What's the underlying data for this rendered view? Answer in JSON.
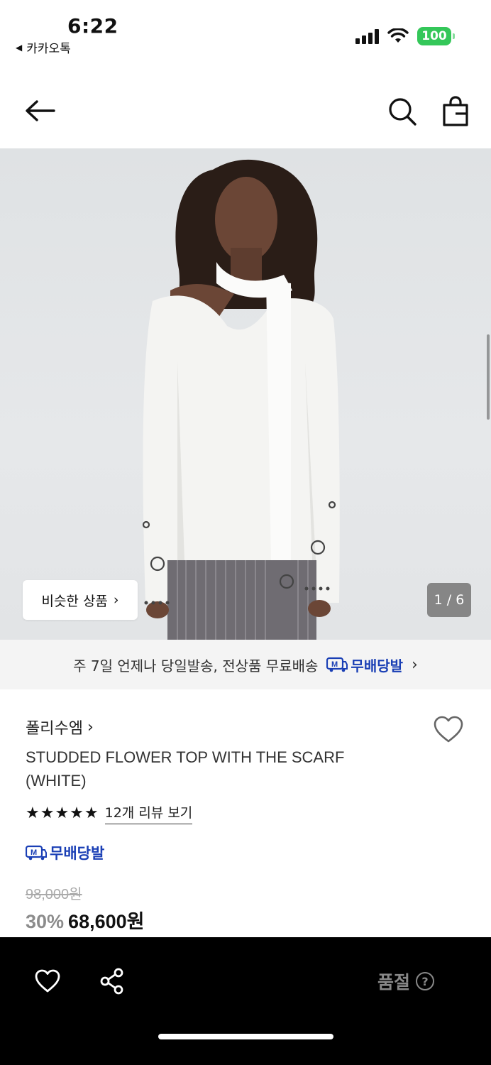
{
  "status_bar": {
    "time": "6:22",
    "back_app": "카카오톡",
    "battery": "100",
    "battery_color": "#34c759"
  },
  "nav": {
    "back_icon": "arrow-left-icon",
    "search_icon": "search-icon",
    "bag_icon": "shopping-bag-icon"
  },
  "hero": {
    "similar_label": "비슷한 상품",
    "page_counter": "1 / 6"
  },
  "shipping_banner": {
    "text": "주 7일 언제나 당일발송, 전상품 무료배송",
    "badge": "무배당발",
    "badge_color": "#1a3fb5"
  },
  "product": {
    "brand": "폴리수엠",
    "title": "STUDDED FLOWER TOP WITH THE SCARF (WHITE)",
    "stars": "★★★★★",
    "rating_value": 5,
    "review_link": "12개 리뷰 보기",
    "badge": "무배당발",
    "original_price": "98,000원",
    "discount": "30%",
    "sale_price": "68,600원"
  },
  "bottom_bar": {
    "soldout_label": "품절",
    "help_glyph": "?"
  }
}
